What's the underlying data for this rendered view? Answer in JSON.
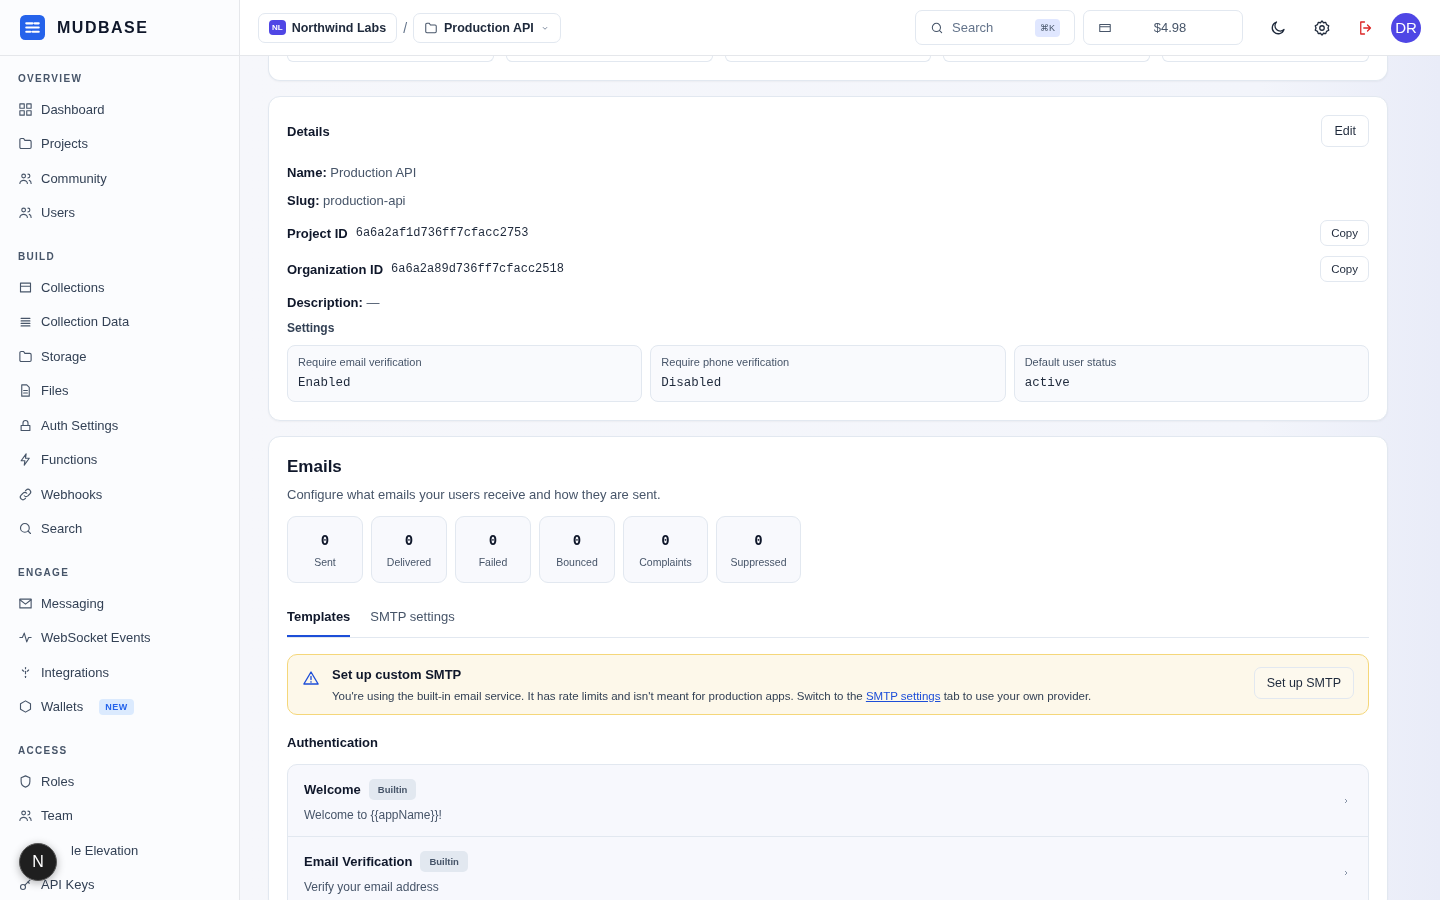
{
  "brand": {
    "name": "MUDBASE"
  },
  "sidebar": {
    "sections": [
      {
        "title": "OVERVIEW",
        "items": [
          {
            "label": "Dashboard"
          },
          {
            "label": "Projects"
          },
          {
            "label": "Community"
          },
          {
            "label": "Users"
          }
        ]
      },
      {
        "title": "BUILD",
        "items": [
          {
            "label": "Collections"
          },
          {
            "label": "Collection Data"
          },
          {
            "label": "Storage"
          },
          {
            "label": "Files"
          },
          {
            "label": "Auth Settings"
          },
          {
            "label": "Functions"
          },
          {
            "label": "Webhooks"
          },
          {
            "label": "Search"
          }
        ]
      },
      {
        "title": "ENGAGE",
        "items": [
          {
            "label": "Messaging"
          },
          {
            "label": "WebSocket Events"
          },
          {
            "label": "Integrations"
          },
          {
            "label": "Wallets",
            "badge": "NEW"
          }
        ]
      },
      {
        "title": "ACCESS",
        "items": [
          {
            "label": "Roles"
          },
          {
            "label": "Team"
          },
          {
            "label": "le Elevation"
          },
          {
            "label": "API Keys"
          }
        ]
      }
    ]
  },
  "floating_button": {
    "label": "N"
  },
  "topbar": {
    "breadcrumb": [
      {
        "label": "Northwind Labs",
        "badge": "NL"
      },
      {
        "label": "Production API"
      }
    ],
    "separator": "/",
    "search": {
      "placeholder": "Search",
      "shortcut": "⌘K"
    },
    "credits": "$4.98",
    "avatar": "DR"
  },
  "details": {
    "title": "Details",
    "edit_button": "Edit",
    "fields": [
      "**Name:** Production API",
      "**Slug:** production-api"
    ],
    "ids": [
      {
        "label": "Project ID",
        "value": "6a6a2af1d736ff7cfacc2753",
        "button": "Copy"
      },
      {
        "label": "Organization ID",
        "value": "6a6a2a89d736ff7cfacc2518",
        "button": "Copy"
      }
    ],
    "description": "**Description:** —",
    "settings_title": "Settings",
    "settings": [
      {
        "label": "Require email verification",
        "value": "Enabled"
      },
      {
        "label": "Require phone verification",
        "value": "Disabled"
      },
      {
        "label": "Default user status",
        "value": "active"
      }
    ]
  },
  "emails": {
    "title": "Emails",
    "subtitle": "Configure what emails your users receive and how they are sent.",
    "stats": [
      {
        "value": "0",
        "label": "Sent"
      },
      {
        "value": "0",
        "label": "Delivered"
      },
      {
        "value": "0",
        "label": "Failed"
      },
      {
        "value": "0",
        "label": "Bounced"
      },
      {
        "value": "0",
        "label": "Complaints"
      },
      {
        "value": "0",
        "label": "Suppressed"
      }
    ],
    "tabs": [
      {
        "label": "Templates",
        "selected": true
      },
      {
        "label": "SMTP settings",
        "selected": false
      }
    ],
    "alert": {
      "title": "Set up custom SMTP",
      "text_before": "You're using the built-in email service. It has rate limits and isn't meant for production apps. Switch to the ",
      "link": "SMTP settings",
      "text_after": " tab to use your own provider.",
      "button": "Set up SMTP"
    },
    "group_title": "Authentication",
    "templates": [
      {
        "name": "Welcome",
        "badge": "Builtin",
        "subject": "Welcome to {{appName}}!"
      },
      {
        "name": "Email Verification",
        "badge": "Builtin",
        "subject": "Verify your email address"
      }
    ]
  }
}
